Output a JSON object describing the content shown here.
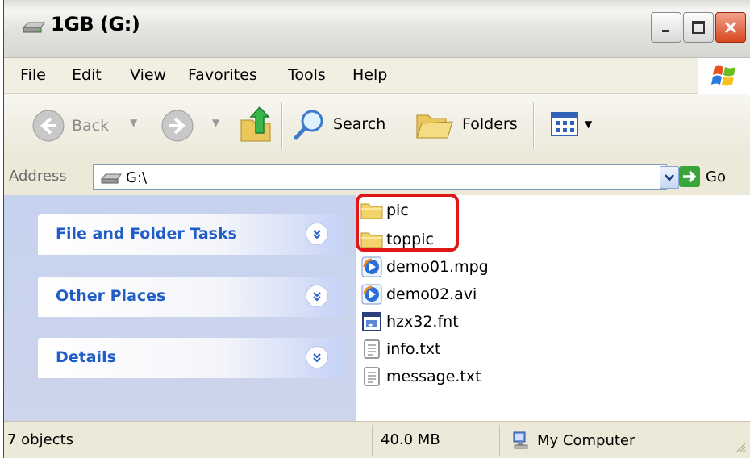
{
  "window": {
    "title": "1GB (G:)"
  },
  "menu": {
    "file": "File",
    "edit": "Edit",
    "view": "View",
    "favorites": "Favorites",
    "tools": "Tools",
    "help": "Help"
  },
  "toolbar": {
    "back": "Back",
    "search": "Search",
    "folders": "Folders"
  },
  "address": {
    "label": "Address",
    "value": "G:\\",
    "go": "Go"
  },
  "taskpane": {
    "panels": [
      {
        "title": "File and Folder Tasks"
      },
      {
        "title": "Other Places"
      },
      {
        "title": "Details"
      }
    ]
  },
  "files": [
    {
      "name": "pic",
      "icon": "folder-icon"
    },
    {
      "name": "toppic",
      "icon": "folder-icon"
    },
    {
      "name": "demo01.mpg",
      "icon": "media-file-icon"
    },
    {
      "name": "demo02.avi",
      "icon": "media-file-icon"
    },
    {
      "name": "hzx32.fnt",
      "icon": "font-file-icon"
    },
    {
      "name": "info.txt",
      "icon": "text-file-icon"
    },
    {
      "name": "message.txt",
      "icon": "text-file-icon"
    }
  ],
  "status": {
    "count": "7 objects",
    "size": "40.0 MB",
    "zone": "My Computer"
  },
  "colors": {
    "highlight": "#e11616",
    "panel_title": "#215dc6"
  }
}
